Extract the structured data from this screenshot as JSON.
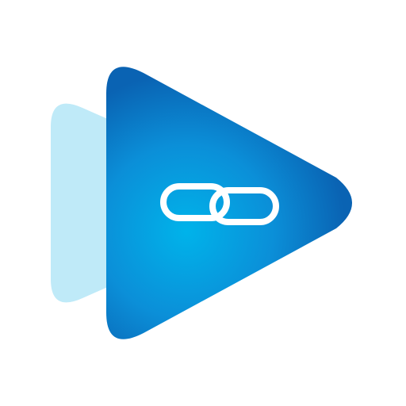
{
  "icon": {
    "name": "play-link-app-icon",
    "back_play_shape_icon": "play-triangle-icon",
    "front_play_shape_icon": "play-triangle-icon",
    "center_symbol_icon": "link-chain-icon"
  },
  "colors": {
    "background": "#ffffff",
    "back_triangle": "#bfeaf8",
    "front_gradient_center": "#00b3ea",
    "front_gradient_mid": "#0b8fd8",
    "front_gradient_edge": "#0a63b3",
    "link_stroke": "#ffffff"
  }
}
